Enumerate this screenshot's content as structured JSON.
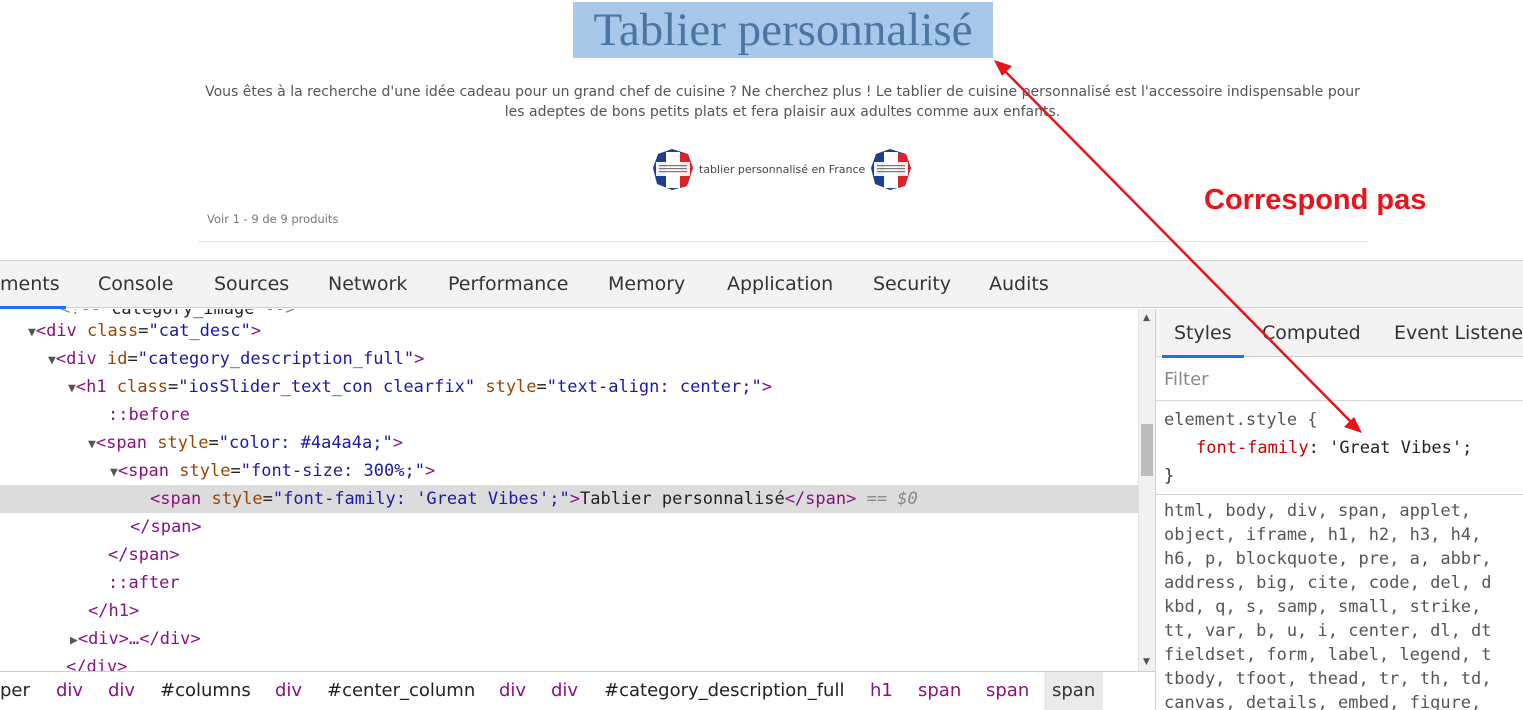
{
  "page": {
    "title": "Tablier personnalisé",
    "description": "Vous êtes à la recherche d'une idée cadeau pour un grand chef de cuisine ? Ne cherchez plus ! Le tablier de cuisine personnalisé est l'accessoire indispensable pour les adeptes de bons petits plats et fera plaisir aux adultes comme aux enfants.",
    "france_label": "tablier personnalisé en France",
    "product_count": "Voir 1 - 9 de 9 produits"
  },
  "annotation": {
    "label": "Correspond pas",
    "color": "#e8141b"
  },
  "devtools": {
    "tabs": [
      "ments",
      "Console",
      "Sources",
      "Network",
      "Performance",
      "Memory",
      "Application",
      "Security",
      "Audits"
    ],
    "active_tab": "ments",
    "dom": {
      "partial_top": "category_image",
      "l1_tag": "div",
      "l1_attr": "class",
      "l1_val": "cat_desc",
      "l2_tag": "div",
      "l2_attr": "id",
      "l2_val": "category_description_full",
      "l3_tag": "h1",
      "l3_attr1": "class",
      "l3_val1": "iosSlider_text_con clearfix",
      "l3_attr2": "style",
      "l3_val2": "text-align: center;",
      "before": "::before",
      "l4_tag": "span",
      "l4_attr": "style",
      "l4_val": "color: #4a4a4a;",
      "l5_tag": "span",
      "l5_attr": "style",
      "l5_val": "font-size: 300%;",
      "l6_tag": "span",
      "l6_attr": "style",
      "l6_val": "font-family: 'Great Vibes';",
      "l6_text": "Tablier personnalisé",
      "l6_marker": "== $0",
      "close_span": "</span>",
      "after": "::after",
      "close_h1": "</h1>",
      "collapsed_div": "<div>…</div>",
      "close_div": "</div>"
    },
    "breadcrumbs": [
      "per",
      "div",
      "div",
      "#columns",
      "div",
      "#center_column",
      "div",
      "div",
      "#category_description_full",
      "h1",
      "span",
      "span",
      "span"
    ],
    "styles": {
      "tabs": [
        "Styles",
        "Computed",
        "Event Listeners"
      ],
      "active_tab": "Styles",
      "filter_placeholder": "Filter",
      "rule_selector": "element.style {",
      "prop_name": "font-family",
      "prop_value": "'Great Vibes';",
      "rule_close": "}",
      "selector_lines": [
        "html, body, div, span, applet,",
        "object, iframe, h1, h2, h3, h4,",
        "h6, p, blockquote, pre, a, abbr,",
        "address, big, cite, code, del, d",
        "kbd, q, s, samp, small, strike, ",
        "tt, var, b, u, i, center, dl, dt",
        "fieldset, form, label, legend, t",
        "tbody, tfoot, thead, tr, th, td,",
        "canvas, details, embed, figure, "
      ]
    }
  }
}
